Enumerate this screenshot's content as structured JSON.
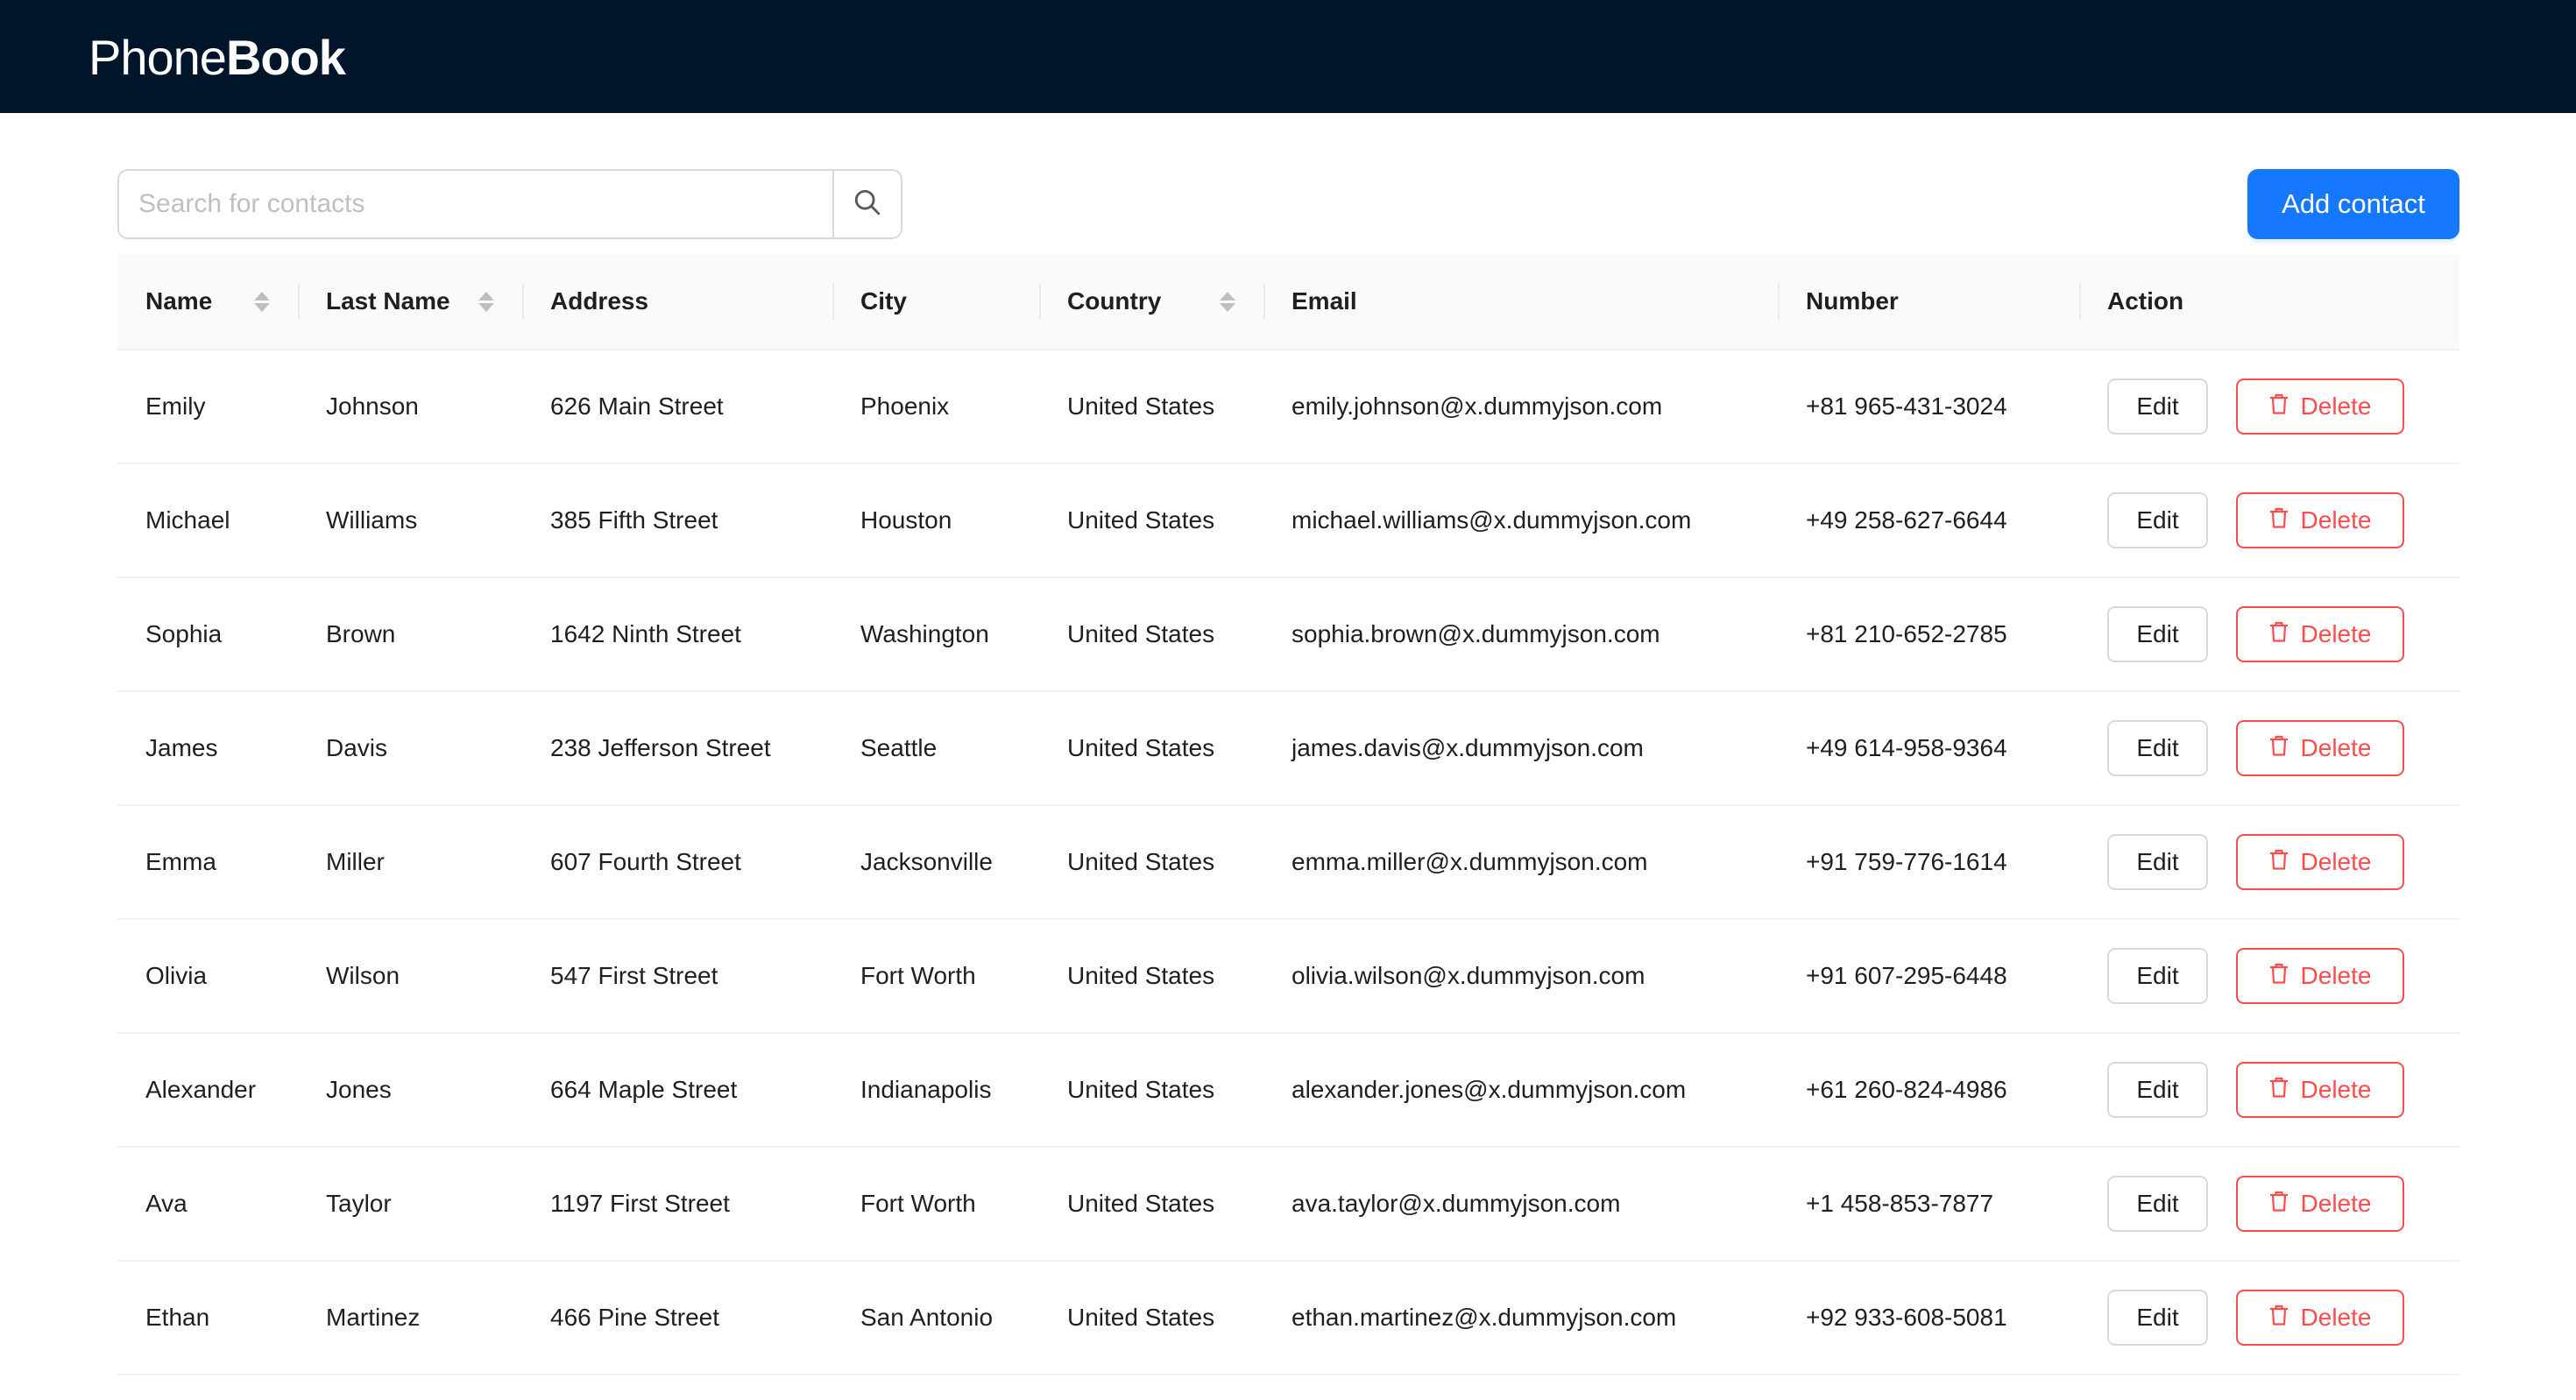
{
  "app": {
    "logo_light": "Phone",
    "logo_bold": "Book"
  },
  "toolbar": {
    "search_placeholder": "Search for contacts",
    "search_value": "",
    "add_label": "Add contact"
  },
  "colors": {
    "header_bg": "#001529",
    "primary": "#1677ff",
    "danger": "#ff4d4f"
  },
  "icons": {
    "search": "search-icon",
    "delete": "trash-icon",
    "sort": "sort-icon"
  },
  "table": {
    "columns": [
      "Name",
      "Last Name",
      "Address",
      "City",
      "Country",
      "Email",
      "Number",
      "Action"
    ],
    "sortable": [
      "Name",
      "Last Name",
      "Country"
    ],
    "edit_label": "Edit",
    "delete_label": "Delete",
    "rows": [
      {
        "name": "Emily",
        "last_name": "Johnson",
        "address": "626 Main Street",
        "city": "Phoenix",
        "country": "United States",
        "email": "emily.johnson@x.dummyjson.com",
        "number": "+81 965-431-3024"
      },
      {
        "name": "Michael",
        "last_name": "Williams",
        "address": "385 Fifth Street",
        "city": "Houston",
        "country": "United States",
        "email": "michael.williams@x.dummyjson.com",
        "number": "+49 258-627-6644"
      },
      {
        "name": "Sophia",
        "last_name": "Brown",
        "address": "1642 Ninth Street",
        "city": "Washington",
        "country": "United States",
        "email": "sophia.brown@x.dummyjson.com",
        "number": "+81 210-652-2785"
      },
      {
        "name": "James",
        "last_name": "Davis",
        "address": "238 Jefferson Street",
        "city": "Seattle",
        "country": "United States",
        "email": "james.davis@x.dummyjson.com",
        "number": "+49 614-958-9364"
      },
      {
        "name": "Emma",
        "last_name": "Miller",
        "address": "607 Fourth Street",
        "city": "Jacksonville",
        "country": "United States",
        "email": "emma.miller@x.dummyjson.com",
        "number": "+91 759-776-1614"
      },
      {
        "name": "Olivia",
        "last_name": "Wilson",
        "address": "547 First Street",
        "city": "Fort Worth",
        "country": "United States",
        "email": "olivia.wilson@x.dummyjson.com",
        "number": "+91 607-295-6448"
      },
      {
        "name": "Alexander",
        "last_name": "Jones",
        "address": "664 Maple Street",
        "city": "Indianapolis",
        "country": "United States",
        "email": "alexander.jones@x.dummyjson.com",
        "number": "+61 260-824-4986"
      },
      {
        "name": "Ava",
        "last_name": "Taylor",
        "address": "1197 First Street",
        "city": "Fort Worth",
        "country": "United States",
        "email": "ava.taylor@x.dummyjson.com",
        "number": "+1 458-853-7877"
      },
      {
        "name": "Ethan",
        "last_name": "Martinez",
        "address": "466 Pine Street",
        "city": "San Antonio",
        "country": "United States",
        "email": "ethan.martinez@x.dummyjson.com",
        "number": "+92 933-608-5081"
      }
    ]
  }
}
